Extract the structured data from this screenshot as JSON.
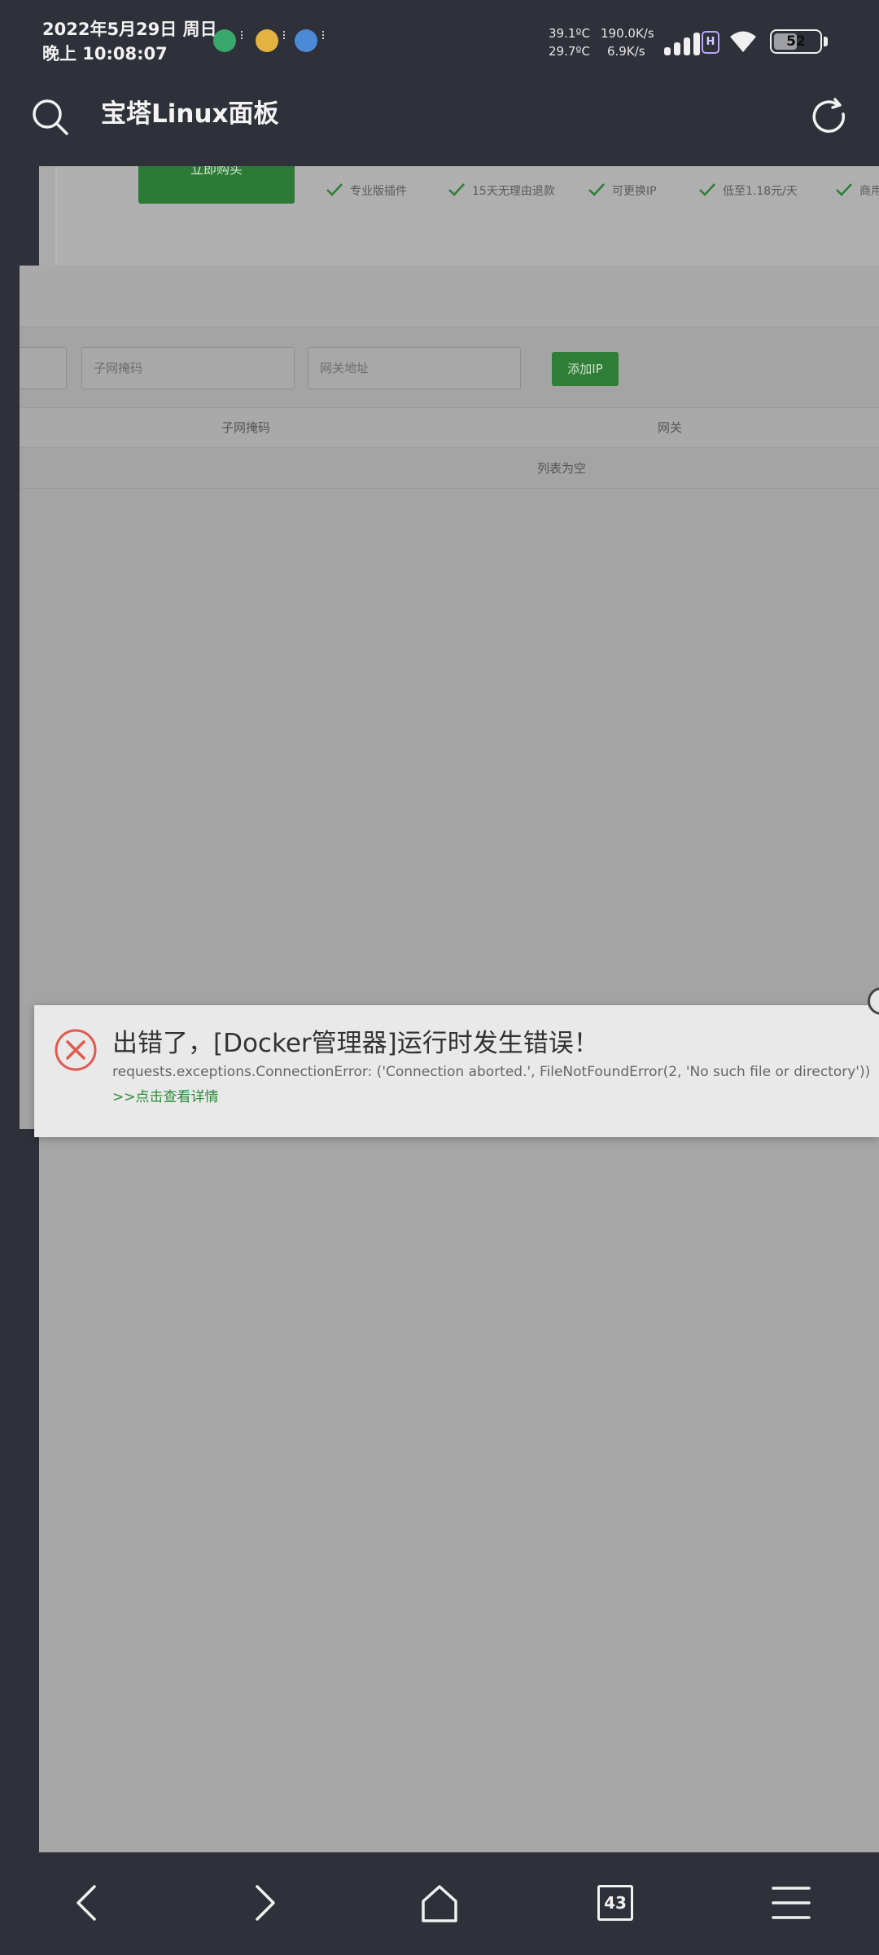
{
  "status_bar": {
    "date": "2022年5月29日 周日",
    "time": "晚上 10:08:07",
    "temp1": "39.1ºC",
    "temp2": "29.7ºC",
    "net_up": "190.0K/s",
    "net_down": "6.9K/s",
    "hd_badge": "H",
    "battery": "52",
    "battery_level": 0.52
  },
  "toolbar": {
    "title": "宝塔Linux面板"
  },
  "page": {
    "buy_button": "立即购买",
    "features": [
      "专业版插件",
      "15天无理由退款",
      "可更换IP",
      "低至1.18元/天",
      "商用防"
    ],
    "subnet_placeholder": "子网掩码",
    "gateway_placeholder": "网关地址",
    "add_ip_button": "添加IP",
    "table_headers": [
      "子网掩码",
      "网关"
    ],
    "empty_text": "列表为空"
  },
  "toast": {
    "title": "出错了，[Docker管理器]运行时发生错误！",
    "detail": "requests.exceptions.ConnectionError: ('Connection aborted.', FileNotFoundError(2, 'No such file or directory'))",
    "link": ">>点击查看详情"
  },
  "bottom_nav": {
    "tab_count": "43"
  },
  "colors": {
    "chrome": "#2e3139",
    "overlay": "#a6a6a6",
    "green": "#2e8a3b",
    "error_red": "#e05a4f"
  }
}
